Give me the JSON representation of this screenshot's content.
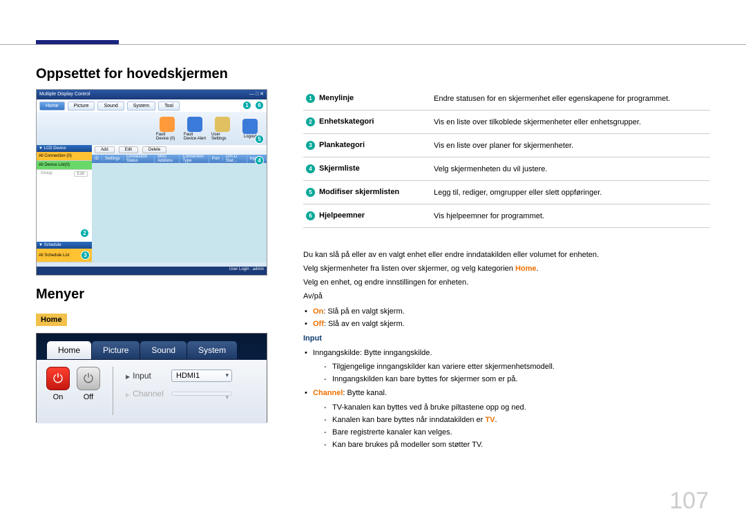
{
  "page": {
    "h1": "Oppsettet for hovedskjermen",
    "h2": "Menyer",
    "home_label": "Home",
    "pagenum": "107"
  },
  "app": {
    "title": "Multiple Display Control",
    "menu": [
      "Home",
      "Picture",
      "Sound",
      "System",
      "Tool"
    ],
    "toolbar": [
      {
        "label": "Fault Device (0)",
        "color": "#ff9a3a"
      },
      {
        "label": "Fault Device Alert",
        "color": "#3a7ad8"
      },
      {
        "label": "User Settings",
        "color": "#e0c060"
      },
      {
        "label": "Logout",
        "color": "#3a7ad8"
      }
    ],
    "side_hdr1": "▼ LCD Device",
    "side_items": [
      {
        "label": "All Connection (0)",
        "cls": "y"
      },
      {
        "label": "All Device List(0)",
        "cls": ""
      }
    ],
    "side_group": "Group",
    "side_edit": "Edit",
    "side_hdr2": "▼ Schedule",
    "side_sched": "All Schedule List",
    "mainbar_btns": [
      "Add",
      "Edit",
      "Delete"
    ],
    "table_cols": [
      "ID",
      "Settings",
      "Connection Status",
      "MAC Address",
      "Connection Type",
      "Port",
      "DVI-D Stat…",
      "Input…"
    ],
    "status": "User Login : admin"
  },
  "callouts": {
    "c1": "1",
    "c2": "2",
    "c3": "3",
    "c4": "4",
    "c5": "5",
    "c6": "6"
  },
  "home_shot": {
    "tabs": [
      "Home",
      "Picture",
      "Sound",
      "System"
    ],
    "on": "On",
    "off": "Off",
    "input_lbl": "Input",
    "input_val": "HDMI1",
    "channel_lbl": "Channel"
  },
  "desc": [
    {
      "n": "1",
      "label": "Menylinje",
      "text": "Endre statusen for en skjermenhet eller egenskapene for programmet."
    },
    {
      "n": "2",
      "label": "Enhetskategori",
      "text": "Vis en liste over tilkoblede skjermenheter eller enhetsgrupper."
    },
    {
      "n": "3",
      "label": "Plankategori",
      "text": "Vis en liste over planer for skjermenheter."
    },
    {
      "n": "4",
      "label": "Skjermliste",
      "text": "Velg skjermenheten du vil justere."
    },
    {
      "n": "5",
      "label": "Modifiser skjermlisten",
      "text": "Legg til, rediger, omgrupper eller slett oppføringer."
    },
    {
      "n": "6",
      "label": "Hjelpeemner",
      "text": "Vis hjelpeemner for programmet."
    }
  ],
  "body": {
    "p1": "Du kan slå på eller av en valgt enhet eller endre inndatakilden eller volumet for enheten.",
    "p2a": "Velg skjermenheter fra listen over skjermer, og velg kategorien ",
    "p2b": "Home",
    "p2c": ".",
    "p3": "Velg en enhet, og endre innstillingen for enheten.",
    "p4": "Av/på",
    "li_on_a": "On",
    "li_on_b": ": Slå på en valgt skjerm.",
    "li_off_a": "Off",
    "li_off_b": ": Slå av en valgt skjerm.",
    "input": "Input",
    "li_src": "Inngangskilde: Bytte inngangskilde.",
    "li_src_d1": "Tilgjengelige inngangskilder kan variere etter skjermenhetsmodell.",
    "li_src_d2": "Inngangskilden kan bare byttes for skjermer som er på.",
    "li_ch_a": "Channel",
    "li_ch_b": ": Bytte kanal.",
    "li_ch_d1": "TV-kanalen kan byttes ved å bruke piltastene opp og ned.",
    "li_ch_d2a": "Kanalen kan bare byttes når inndatakilden er ",
    "li_ch_d2b": "TV",
    "li_ch_d2c": ".",
    "li_ch_d3": "Bare registrerte kanaler kan velges.",
    "li_ch_d4": "Kan bare brukes på modeller som støtter TV."
  }
}
